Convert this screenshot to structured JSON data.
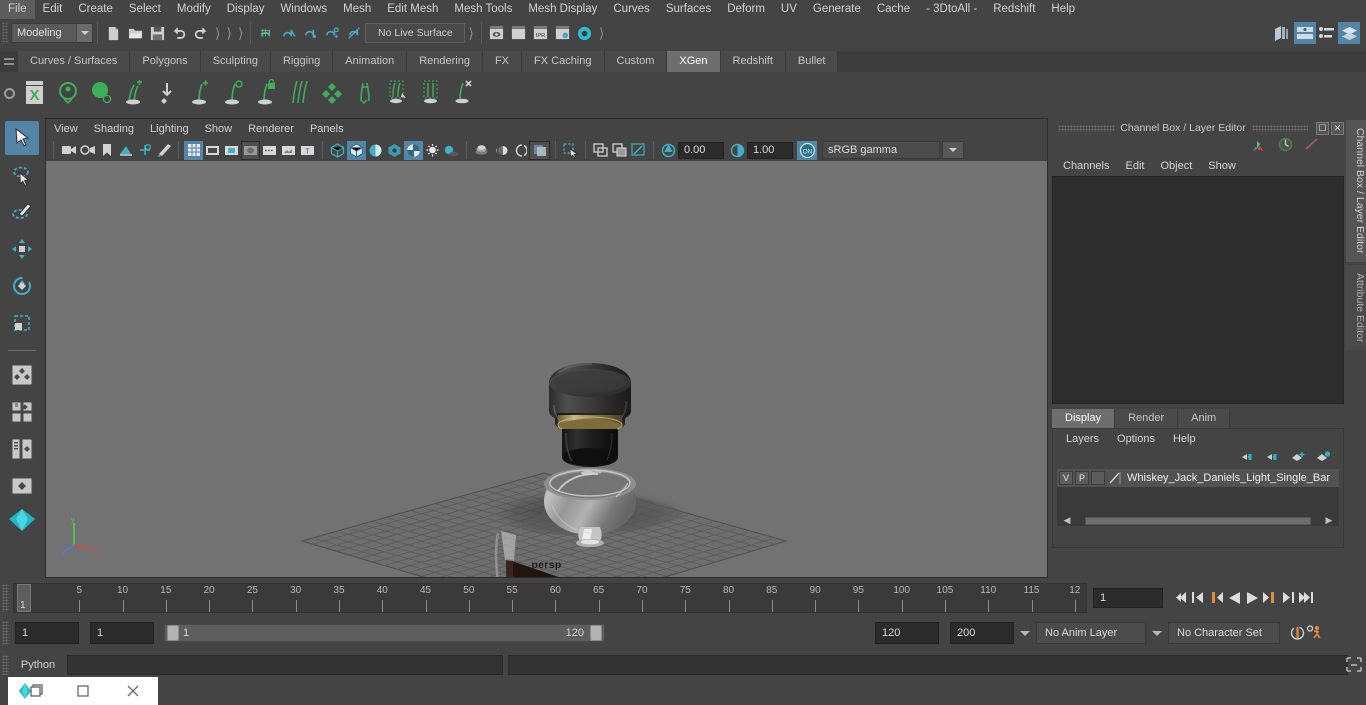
{
  "menubar": {
    "items": [
      "File",
      "Edit",
      "Create",
      "Select",
      "Modify",
      "Display",
      "Windows",
      "Mesh",
      "Edit Mesh",
      "Mesh Tools",
      "Mesh Display",
      "Curves",
      "Surfaces",
      "Deform",
      "UV",
      "Generate",
      "Cache",
      "- 3DtoAll -",
      "Redshift",
      "Help"
    ]
  },
  "statusline": {
    "menu_set": "Modeling",
    "live_surface": "No Live Surface",
    "icons": [
      "new-scene-icon",
      "open-scene-icon",
      "save-scene-icon",
      "undo-icon",
      "redo-icon",
      "select-by-hierarchy-icon",
      "select-by-object-icon",
      "select-by-component-icon",
      "snap-to-grid-icon",
      "snap-to-curve-icon",
      "snap-to-point-icon",
      "snap-to-projected-center-icon",
      "snap-to-view-plane-icon",
      "render-current-frame-icon",
      "ipr-render-icon",
      "render-settings-icon",
      "hypershade-icon",
      "show-hide-editor-icon",
      "channel-box-toggle-icon",
      "attribute-editor-toggle-icon",
      "tool-settings-toggle-icon"
    ]
  },
  "shelf": {
    "tabs": [
      "Curves / Surfaces",
      "Polygons",
      "Sculpting",
      "Rigging",
      "Animation",
      "Rendering",
      "FX",
      "FX Caching",
      "Custom",
      "XGen",
      "Redshift",
      "Bullet"
    ],
    "active_tab": "XGen",
    "buttons": [
      "xgen-editor-icon",
      "xgen-preview-icon",
      "xgen-sphere-icon",
      "xgen-add-grooming-icon",
      "xgen-place-guide-icon",
      "xgen-add-guide-icon",
      "xgen-modify-guide-icon",
      "xgen-lock-guide-icon",
      "xgen-comb-icon",
      "xgen-density-icon",
      "xgen-cut-icon",
      "xgen-part-icon",
      "xgen-clump-icon",
      "xgen-delete-icon"
    ]
  },
  "toolbox": {
    "items": [
      {
        "name": "select-tool",
        "selected": true
      },
      {
        "name": "lasso-select-tool",
        "selected": false
      },
      {
        "name": "paint-select-tool",
        "selected": false
      },
      {
        "name": "move-tool",
        "selected": false
      },
      {
        "name": "rotate-tool",
        "selected": false
      },
      {
        "name": "scale-tool",
        "selected": false
      },
      {
        "name": "four-view-layout-icon",
        "selected": false
      },
      {
        "name": "split-layout-icon",
        "selected": false
      },
      {
        "name": "outliner-persp-layout-icon",
        "selected": false
      },
      {
        "name": "single-persp-layout-icon",
        "selected": false
      },
      {
        "name": "workspace-selector-icon",
        "selected": false
      }
    ]
  },
  "viewport": {
    "menus": [
      "View",
      "Shading",
      "Lighting",
      "Show",
      "Renderer",
      "Panels"
    ],
    "camera_label": "persp",
    "exposure_value": "0.00",
    "gamma_value": "1.00",
    "color_management": "sRGB gamma",
    "color_management_toggle": "ON",
    "toolbar_icons": [
      "select-camera-icon",
      "camera-attributes-icon",
      "bookmark-icon",
      "image-plane-icon",
      "two-d-pan-zoom-icon",
      "grease-pencil-icon",
      "grid-toggle-icon",
      "film-gate-icon",
      "resolution-gate-icon",
      "gate-mask-icon",
      "film-origin-icon",
      "safe-action-icon",
      "text-overlay-icon",
      "wireframe-icon",
      "smooth-shade-all-icon",
      "shaded-wireframe-icon",
      "use-default-material-icon",
      "textured-icon",
      "lighting-icon",
      "shadows-icon",
      "ambient-occlusion-icon",
      "motion-blur-icon",
      "multisample-icon",
      "xray-icon",
      "xray-joints-icon",
      "xray-active-components-icon",
      "isolate-select-icon",
      "frame-all-icon",
      "frame-selected-icon",
      "exposure-icon",
      "gamma-icon",
      "color-management-icon"
    ]
  },
  "channel_box": {
    "panel_title": "Channel Box / Layer Editor",
    "menus": [
      "Channels",
      "Edit",
      "Object",
      "Show"
    ],
    "header_icons": [
      "transform-channels-icon",
      "output-channels-icon",
      "shape-channels-icon"
    ],
    "content": ""
  },
  "layer_editor": {
    "tabs": [
      "Display",
      "Render",
      "Anim"
    ],
    "active_tab": "Display",
    "menus": [
      "Layers",
      "Options",
      "Help"
    ],
    "buttons": [
      "move-layer-up-icon",
      "move-layer-down-icon",
      "create-new-layer-icon",
      "create-layer-from-selected-icon"
    ],
    "layers": [
      {
        "visibility": "V",
        "playback": "P",
        "color_swatch": "",
        "name": "Whiskey_Jack_Daniels_Light_Single_Bar"
      }
    ]
  },
  "vertical_tabs": [
    {
      "label": "Channel Box / Layer Editor",
      "active": true
    },
    {
      "label": "Attribute Editor",
      "active": false
    }
  ],
  "time_slider": {
    "tick_labels": [
      "5",
      "10",
      "15",
      "20",
      "25",
      "30",
      "35",
      "40",
      "45",
      "50",
      "55",
      "60",
      "65",
      "70",
      "75",
      "80",
      "85",
      "90",
      "95",
      "100",
      "105",
      "110",
      "115",
      "12"
    ],
    "current_frame_marker": "1",
    "current_frame_field": "1",
    "playback_buttons": [
      "go-to-start-icon",
      "step-back-keyframe-icon",
      "step-back-frame-icon",
      "play-backwards-icon",
      "play-forwards-icon",
      "step-forward-frame-icon",
      "step-forward-keyframe-icon",
      "go-to-end-icon"
    ]
  },
  "range_row": {
    "anim_start": "1",
    "range_start": "1",
    "range_bar_start": "1",
    "range_bar_end": "120",
    "range_end": "120",
    "anim_end": "200",
    "anim_layer": "No Anim Layer",
    "character_set": "No Character Set",
    "icons": [
      "auto-keyframe-icon",
      "animation-preferences-icon"
    ]
  },
  "command_line": {
    "language_label": "Python",
    "input_value": "",
    "result_value": "",
    "script-editor-icon": "script-editor-icon"
  },
  "taskbar": {
    "items": [
      "maya-app-icon",
      "restore-window-icon",
      "maximize-window-icon",
      "close-window-icon"
    ]
  }
}
